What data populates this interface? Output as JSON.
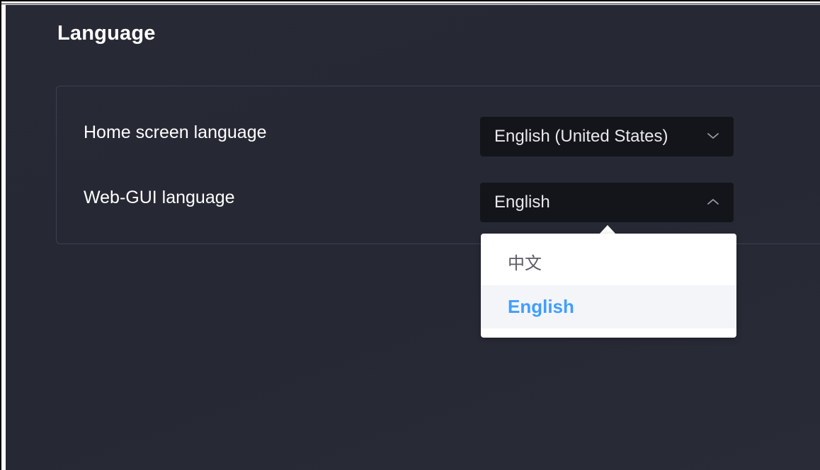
{
  "page": {
    "title": "Language"
  },
  "settings": {
    "home_screen": {
      "label": "Home screen language",
      "value": "English (United States)"
    },
    "web_gui": {
      "label": "Web-GUI language",
      "value": "English",
      "open": true
    }
  },
  "dropdown": {
    "options": [
      {
        "label": "中文",
        "selected": false
      },
      {
        "label": "English",
        "selected": true
      }
    ]
  },
  "colors": {
    "background": "#272935",
    "select_bg": "#14151b",
    "accent": "#409eff",
    "text": "#ffffff"
  },
  "icons": {
    "home_screen_arrow": "chevron-down-icon",
    "web_gui_arrow": "chevron-up-icon"
  }
}
